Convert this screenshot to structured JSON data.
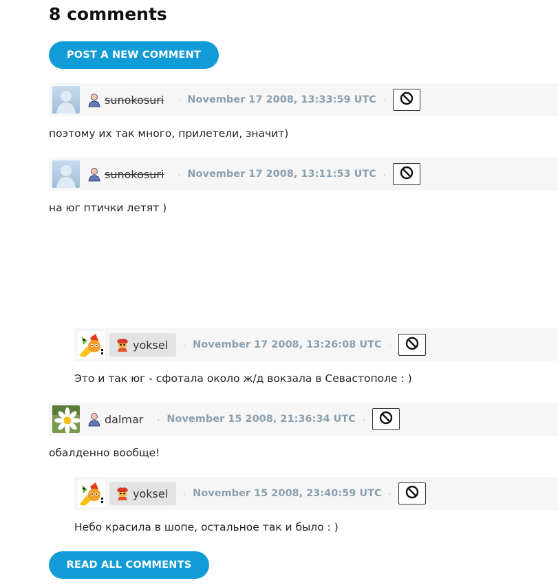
{
  "header": {
    "title": "8 comments"
  },
  "actions": {
    "post_label": "POST A NEW COMMENT",
    "read_label": "READ ALL COMMENTS"
  },
  "separator": "·",
  "comments": [
    {
      "username": "sunokosuri",
      "date": "November 17 2008, 13:33:59 UTC",
      "text": "поэтому их так много, прилетели, значит)",
      "deleted_user": true,
      "avatar": "default-avatar",
      "user_icon": "person-icon"
    },
    {
      "username": "sunokosuri",
      "date": "November 17 2008, 13:11:53 UTC",
      "text": "на юг птички летят )",
      "deleted_user": true,
      "avatar": "default-avatar",
      "user_icon": "person-icon"
    },
    {
      "username": "yoksel",
      "date": "November 17 2008, 13:26:08 UTC",
      "text": "Это и так юг - сфотала около ж/д вокзала в Севастополе : )",
      "reply": true,
      "avatar": "cartoon-avatar",
      "user_icon": "custom-userpic-icon"
    },
    {
      "username": "dalmar",
      "date": "November 15 2008, 21:36:34 UTC",
      "text": "обалденно вообще!",
      "avatar": "daisy-avatar",
      "user_icon": "person-icon"
    },
    {
      "username": "yoksel",
      "date": "November 15 2008, 23:40:59 UTC",
      "text": "Небо красила в шопе, остальное так и было : )",
      "reply": true,
      "avatar": "cartoon-avatar",
      "user_icon": "custom-userpic-icon"
    }
  ],
  "colors": {
    "accent": "#119bd7",
    "date": "#8ba0ae",
    "bar_bg": "#f6f6f6"
  }
}
